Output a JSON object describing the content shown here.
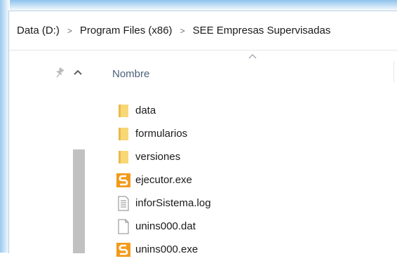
{
  "breadcrumb": {
    "items": [
      "Data (D:)",
      "Program Files (x86)",
      "SEE Empresas Supervisadas"
    ],
    "separator": ">"
  },
  "nav_pane": {
    "pin_icon": "pin-icon",
    "scroll_up_icon": "chevron-up-icon"
  },
  "file_list": {
    "column_header": "Nombre",
    "sort_direction": "ascending",
    "items": [
      {
        "name": "data",
        "type": "folder",
        "icon": "folder-icon"
      },
      {
        "name": "formularios",
        "type": "folder",
        "icon": "folder-icon"
      },
      {
        "name": "versiones",
        "type": "folder",
        "icon": "folder-icon"
      },
      {
        "name": "ejecutor.exe",
        "type": "exe",
        "icon": "app-icon"
      },
      {
        "name": "inforSistema.log",
        "type": "log",
        "icon": "text-file-icon"
      },
      {
        "name": "unins000.dat",
        "type": "dat",
        "icon": "blank-file-icon"
      },
      {
        "name": "unins000.exe",
        "type": "exe",
        "icon": "app-icon"
      }
    ]
  },
  "colors": {
    "folder": "#f8d775",
    "app_orange": "#f39a1a",
    "header_text": "#4c607a",
    "scroll_thumb": "#c1c1c1"
  }
}
